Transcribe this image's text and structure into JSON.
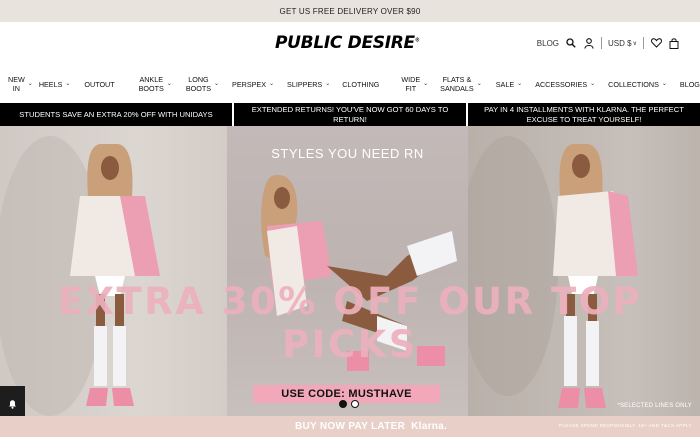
{
  "announcement": "GET US FREE DELIVERY OVER $90",
  "logo": {
    "text": "PUBLIC DESIRE",
    "mark": "®"
  },
  "header_right": {
    "blog": "BLOG",
    "currency": "USD $"
  },
  "nav": [
    {
      "label": "NEW\nIN",
      "chevron": true
    },
    {
      "label": "HEELS",
      "chevron": true
    },
    {
      "label": "OUTOUT",
      "chevron": false
    },
    {
      "label": "ANKLE\nBOOTS",
      "chevron": true
    },
    {
      "label": "LONG\nBOOTS",
      "chevron": true
    },
    {
      "label": "PERSPEX",
      "chevron": true
    },
    {
      "label": "SLIPPERS",
      "chevron": true
    },
    {
      "label": "CLOTHING",
      "chevron": false
    },
    {
      "label": "WIDE\nFIT",
      "chevron": true
    },
    {
      "label": "FLATS &\nSANDALS",
      "chevron": true
    },
    {
      "label": "SALE",
      "chevron": true
    },
    {
      "label": "ACCESSORIES",
      "chevron": true
    },
    {
      "label": "COLLECTIONS",
      "chevron": true
    },
    {
      "label": "BLOG",
      "chevron": false
    }
  ],
  "promos": [
    "STUDENTS SAVE AN EXTRA 20% OFF WITH UNIDAYS",
    "EXTENDED RETURNS! YOU'VE NOW GOT 60 DAYS TO RETURN!",
    "PAY IN 4 INSTALLMENTS WITH KLARNA. THE PERFECT EXCUSE TO TREAT YOURSELF!"
  ],
  "hero": {
    "subtitle": "STYLES YOU NEED RN",
    "headline": "EXTRA 30% OFF OUR TOP PICKS",
    "code": "USE CODE: MUSTHAVE",
    "fine_print": "*SELECTED LINES ONLY",
    "slide_count": 2,
    "active_slide": 1
  },
  "footer": {
    "bnpl": "BUY NOW PAY LATER",
    "klarna": "Klarna.",
    "spend": "PLEASE SPEND RESPONSIBLY. 18+ AND T&CS APPLY"
  },
  "colors": {
    "headline_pink": "#ecb0bc",
    "code_pink": "#f2a8b8",
    "footer_bg": "#e8d0c8",
    "announce_bg": "#e8e3dd"
  }
}
